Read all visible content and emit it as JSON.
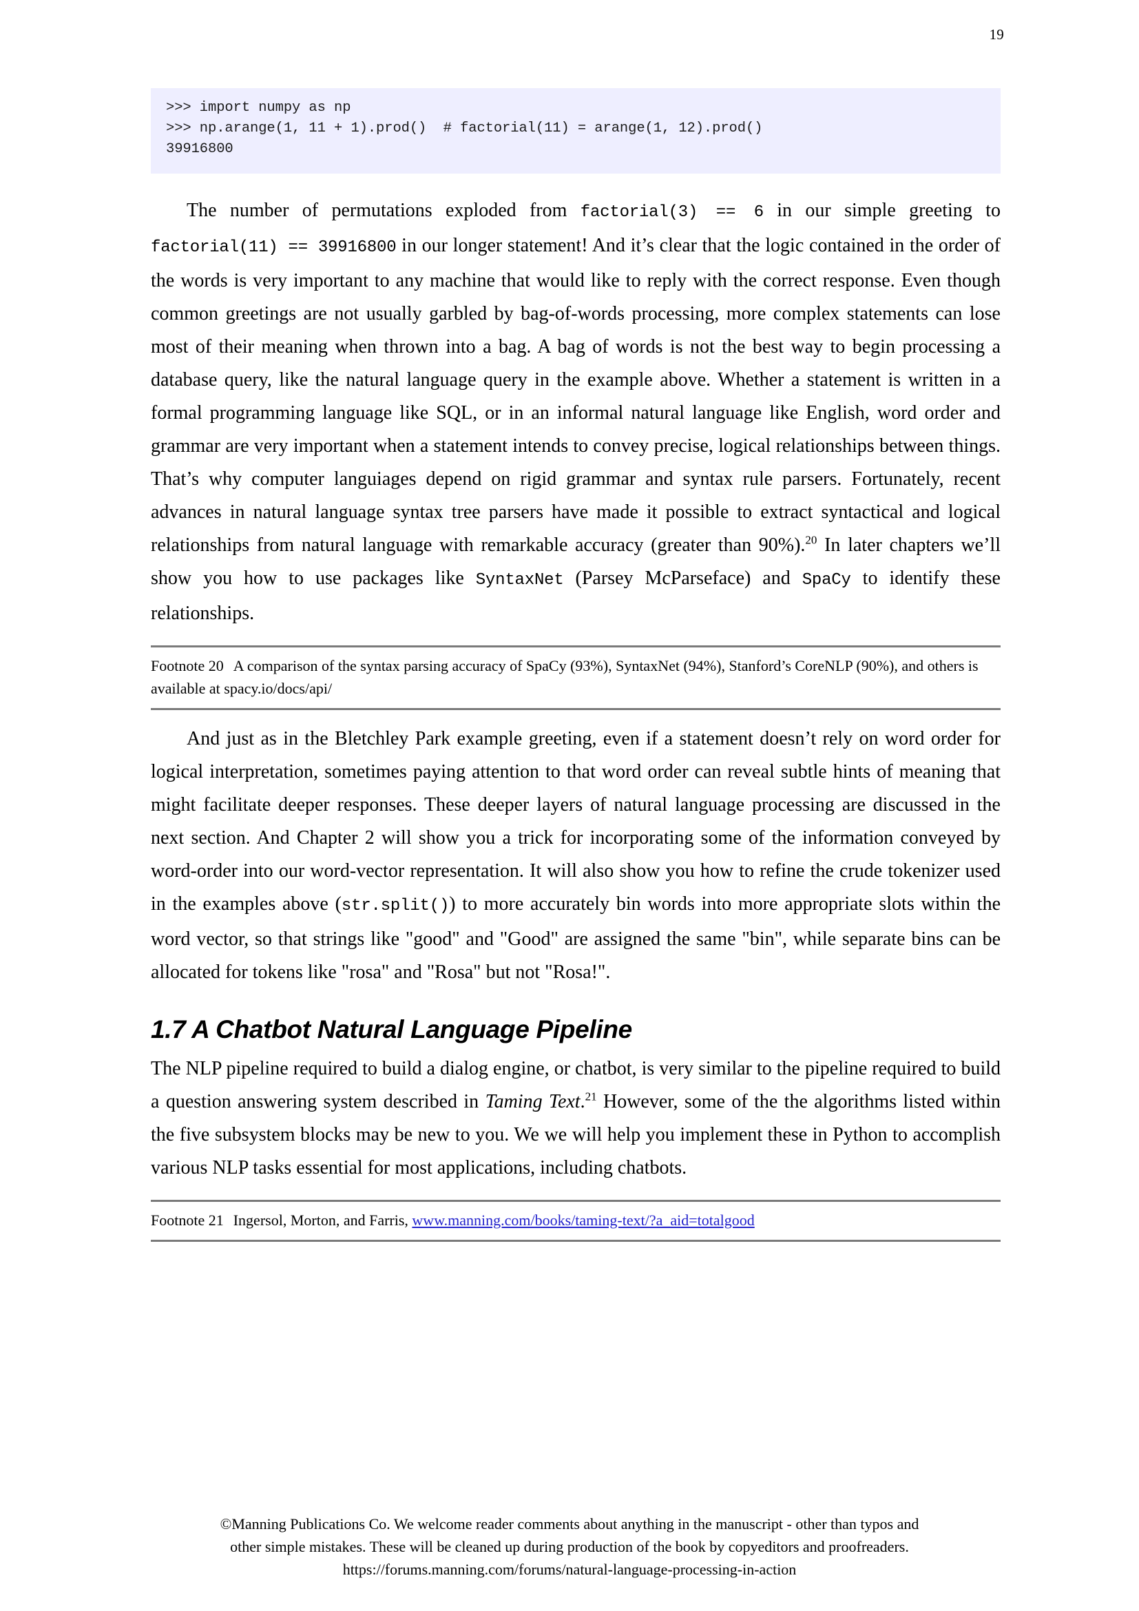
{
  "page": {
    "number": "19"
  },
  "code_block": {
    "lines": [
      ">>> import numpy as np",
      ">>> np.arange(1, 11 + 1).prod()  # factorial(11) = arange(1, 12).prod()",
      "39916800"
    ]
  },
  "paragraph1": {
    "seg1": "The number of permutations exploded from ",
    "code1": "factorial(3) == 6",
    "seg2": " in our simple greeting to ",
    "code2": "factorial(11) == 39916800",
    "seg3": " in our longer statement! And it’s clear that the logic contained in the order of the words is very important to any machine that would like to reply with the correct response. Even though common greetings are not usually garbled by bag-of-words processing, more complex statements can lose most of their meaning when thrown into a bag. A bag of words is not the best way to begin processing a database query, like the natural language query in the example above. Whether a statement is written in a formal programming language like SQL, or in an informal natural language like English, word order and grammar are very important when a statement intends to convey precise, logical relationships between things. That’s why computer languiages depend on rigid grammar and syntax rule parsers. Fortunately, recent advances in natural language syntax tree parsers have made it possible to extract syntactical and logical relationships from natural language with remarkable accuracy (greater than 90%).",
    "footnote_marker": "20",
    "seg4": " In later chapters we’ll show you how to use packages like ",
    "code3": "SyntaxNet",
    "seg5": " (Parsey McParseface) and ",
    "code4": "SpaCy",
    "seg6": " to identify these relationships."
  },
  "footnote20": {
    "label": "Footnote 20",
    "text": "A comparison of the syntax parsing accuracy of SpaCy (93%), SyntaxNet (94%), Stanford’s CoreNLP (90%), and others is available at spacy.io/docs/api/"
  },
  "paragraph2": {
    "seg1": "And just as in the Bletchley Park example greeting, even if a statement doesn’t rely on word order for logical interpretation, sometimes paying attention to that word order can reveal subtle hints of meaning that might facilitate deeper responses. These deeper layers of natural language processing are discussed in the next section. And Chapter 2 will show you a trick for incorporating some of the information conveyed by word-order into our word-vector representation. It will also show you how to refine the crude tokenizer used in the examples above (",
    "code1": "str.split()",
    "seg2": ") to more accurately bin words into more appropriate slots within the word vector, so that strings like \"good\" and \"Good\" are assigned the same \"bin\", while separate bins can be allocated for tokens like \"rosa\" and \"Rosa\" but not \"Rosa!\"."
  },
  "section": {
    "heading": "1.7 A Chatbot Natural Language Pipeline"
  },
  "paragraph3": {
    "seg1": "The NLP pipeline required to build a dialog engine, or chatbot, is very similar to the pipeline required to build a question answering system described in ",
    "italic1": "Taming Text",
    "seg2": ".",
    "footnote_marker": "21",
    "seg3": " However, some of the the algorithms listed within the five subsystem blocks may be new to you. We we will help you implement these in Python to accomplish various NLP tasks essential for most applications, including chatbots."
  },
  "footnote21": {
    "label": "Footnote 21",
    "text": "Ingersol, Morton, and Farris,",
    "link": "www.manning.com/books/taming-text/?a_aid=totalgood"
  },
  "footer": {
    "line1": "©Manning Publications Co. We welcome reader comments about anything in the manuscript - other than typos and",
    "line2": "other simple mistakes. These will be cleaned up during production of the book by copyeditors and proofreaders.",
    "line3": "https://forums.manning.com/forums/natural-language-processing-in-action"
  },
  "colors": {
    "code_background": "#eeeeff",
    "link": "#2222cc",
    "rule": "#7a7a7a"
  }
}
